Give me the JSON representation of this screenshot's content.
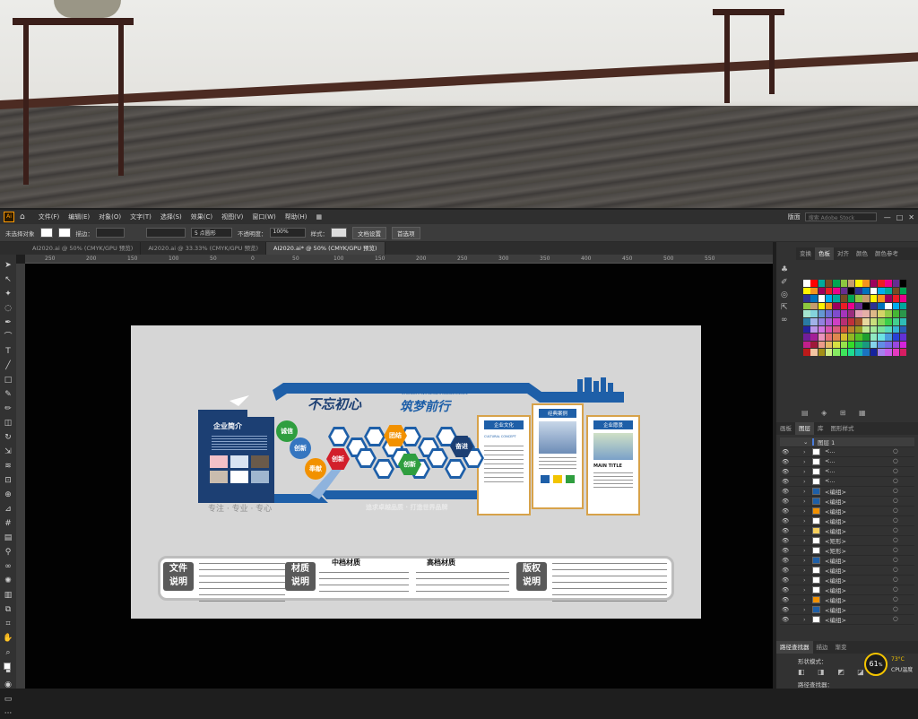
{
  "menu": {
    "items": [
      "文件(F)",
      "编辑(E)",
      "对象(O)",
      "文字(T)",
      "选择(S)",
      "效果(C)",
      "视图(V)",
      "窗口(W)",
      "帮助(H)"
    ],
    "workspace": "版面",
    "search_placeholder": "搜索 Adobe Stock"
  },
  "control": {
    "selection": "未选择对象",
    "stroke_label": "描边：",
    "brush": "5 点圆形",
    "opacity_label": "不透明度：",
    "opacity": "100%",
    "style_label": "样式：",
    "doc_setup": "文档设置",
    "prefs": "首选项"
  },
  "tabs": [
    "AI2020.ai @ 50% (CMYK/GPU 预览)",
    "AI2020.ai @ 33.33% (CMYK/GPU 预览)",
    "AI2020.ai* @ 50% (CMYK/GPU 预览)"
  ],
  "ruler": [
    "250",
    "200",
    "150",
    "100",
    "50",
    "0",
    "50",
    "100",
    "150",
    "200",
    "250",
    "300",
    "350",
    "400",
    "450",
    "500",
    "550"
  ],
  "panel": {
    "tabs_top": [
      "变换",
      "色板",
      "对齐",
      "颜色",
      "颜色参考"
    ],
    "tabs_layers": [
      "画板",
      "图层",
      "库",
      "图形样式"
    ],
    "layer1": "图层 1",
    "layers": [
      "<...",
      "<...",
      "<...",
      "<...",
      "<编组>",
      "<编组>",
      "<编组>",
      "<编组>",
      "<编组>",
      "<矩形>",
      "<矩形>",
      "<编组>",
      "<编组>",
      "<编组>",
      "<编组>",
      "<编组>",
      "<编组>",
      "<编组>"
    ],
    "tabs_bottom": [
      "路径查找器",
      "描边",
      "渐变"
    ],
    "shape_mode": "形状模式：",
    "pathfinder": "路径查找器：",
    "cpu_percent": "61",
    "cpu_temp": "73°C",
    "cpu_label": "CPU温度"
  },
  "art": {
    "title_left": "不忘初心",
    "title_right": "筑梦前行",
    "subtitle_en": "STRENGTH WITNESSES MAGNIFICENCE",
    "intro_title": "企业简介",
    "slogan_left": "专注 · 专业 · 专心",
    "slogan_bottom": "追求卓越品质 · 打造世界品牌",
    "values": [
      "诚信",
      "创新",
      "团结",
      "奉献",
      "创新",
      "奋进"
    ],
    "card1": "企业文化",
    "card2": "经典案例",
    "card3": "企业愿景",
    "card3_en": "MAIN TITLE",
    "culture_en": "CULTURAL CONCEPT"
  },
  "notes": {
    "file": "文件\n说明",
    "material": "材质\n说明",
    "copyright": "版权\n说明",
    "mid": "中档材质",
    "high": "高档材质"
  },
  "colors": {
    "accent": "#1e5fa8",
    "dark_blue": "#1c3f73",
    "orange": "#f29100",
    "gold": "#d7a24a"
  }
}
